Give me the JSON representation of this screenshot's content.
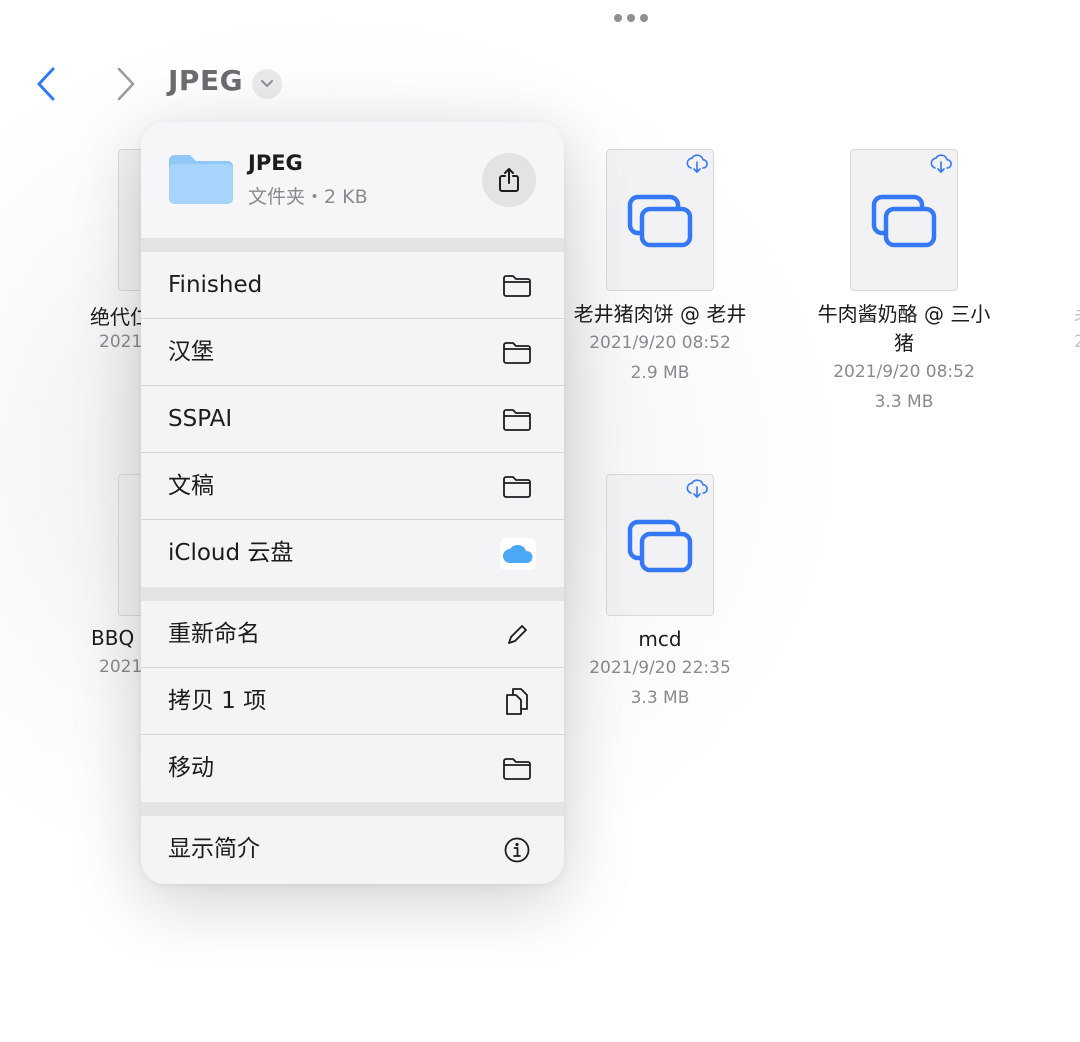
{
  "toolbar": {
    "title": "JPEG"
  },
  "files": [
    {
      "name_line1": "老井猪肉饼 @ 老井",
      "name_line2": "",
      "date": "2021/9/20 08:52",
      "size": "2.9 MB"
    },
    {
      "name_line1": "牛肉酱奶酪 @ 三小",
      "name_line2": "猪",
      "date": "2021/9/20 08:52",
      "size": "3.3 MB"
    },
    {
      "name_line1": "mcd",
      "name_line2": "",
      "date": "2021/9/20 22:35",
      "size": "3.3 MB"
    }
  ],
  "partial_left": [
    {
      "name": "绝代仁",
      "date": "2021"
    },
    {
      "name": "BBQ",
      "date": "2021"
    }
  ],
  "partial_right": {
    "name": "老",
    "date": "2"
  },
  "menu": {
    "header": {
      "name": "JPEG",
      "subtitle": "文件夹・2 KB"
    },
    "destinations": [
      {
        "label": "Finished",
        "icon": "folder-icon"
      },
      {
        "label": "汉堡",
        "icon": "folder-icon"
      },
      {
        "label": "SSPAI",
        "icon": "folder-icon"
      },
      {
        "label": "文稿",
        "icon": "folder-icon"
      },
      {
        "label": "iCloud 云盘",
        "icon": "icloud-icon"
      }
    ],
    "actions": [
      {
        "label": "重新命名",
        "icon": "pencil-icon"
      },
      {
        "label": "拷贝 1 项",
        "icon": "copy-icon"
      },
      {
        "label": "移动",
        "icon": "folder-icon"
      }
    ],
    "info": {
      "label": "显示简介",
      "icon": "info-icon"
    }
  },
  "colors": {
    "accent": "#3478f6",
    "folder": "#a6d4fa"
  }
}
